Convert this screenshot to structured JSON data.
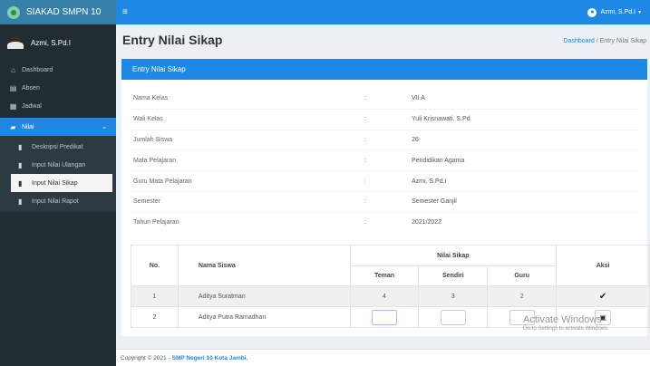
{
  "app": {
    "title": "SIAKAD SMPN 10"
  },
  "user": {
    "name": "Azmi, S.Pd.I",
    "top_name": "Azmi, S.Pd.I"
  },
  "sidebar": {
    "items": [
      {
        "label": "Dashboard",
        "icon": "home-icon"
      },
      {
        "label": "Absen",
        "icon": "book-icon"
      },
      {
        "label": "Jadwal",
        "icon": "calendar-icon"
      },
      {
        "label": "Nilai",
        "icon": "folder-icon"
      }
    ],
    "submenu": [
      {
        "label": "Deskripsi Predikat"
      },
      {
        "label": "Input Nilai Ulangan"
      },
      {
        "label": "Input Nilai Sikap"
      },
      {
        "label": "Input Nilai Rapot"
      }
    ]
  },
  "header": {
    "page_title": "Entry Nilai Sikap",
    "breadcrumb_home": "Dashboard",
    "breadcrumb_sep": " / ",
    "breadcrumb_current": "Entry Nilai Sikap"
  },
  "box": {
    "title": "Entry Nilai Sikap"
  },
  "info": [
    {
      "label": "Nama Kelas",
      "sep": ":",
      "value": "VII A"
    },
    {
      "label": "Wali Kelas",
      "sep": ":",
      "value": "Yuli Krisnawati. S.Pd"
    },
    {
      "label": "Jumlah Siswa",
      "sep": ":",
      "value": "26"
    },
    {
      "label": "Mata Pelajaran",
      "sep": ":",
      "value": "Pendidikan Agama"
    },
    {
      "label": "Guru Mata Pelajaran",
      "sep": ":",
      "value": "Azmi, S.Pd.I"
    },
    {
      "label": "Semester",
      "sep": ":",
      "value": "Semester Ganjil"
    },
    {
      "label": "Tahun Pelajaran",
      "sep": ":",
      "value": "2021/2022"
    }
  ],
  "table": {
    "headers": {
      "no": "No.",
      "nama": "Nama Siswa",
      "nilai": "Nilai Sikap",
      "teman": "Teman",
      "sendiri": "Sendiri",
      "guru": "Guru",
      "aksi": "Aksi"
    },
    "rows": [
      {
        "no": "1",
        "nama": "Aditya Suratman",
        "teman": "4",
        "sendiri": "3",
        "guru": "2",
        "aksi": "check-icon"
      },
      {
        "no": "2",
        "nama": "Aditya Putra Ramadhan",
        "teman": "",
        "sendiri": "",
        "guru": "",
        "aksi": "save-icon"
      }
    ]
  },
  "watermark": {
    "line1": "Activate Windows",
    "line2": "Go to Settings to activate Windows."
  },
  "footer": {
    "text": "Copyright © 2021 -",
    "link": "SMP Negeri 10 Kota Jambi."
  }
}
